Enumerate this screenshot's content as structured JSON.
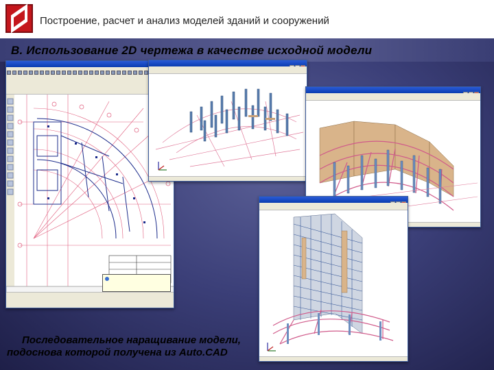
{
  "header": {
    "title": "Построение, расчет и анализ моделей зданий и сооружений",
    "brand_color": "#c4161c"
  },
  "subtitle": "B. Использование 2D чертежа в качестве исходной модели",
  "caption": {
    "line1": "Последовательное наращивание модели,",
    "line2": "подоснова которой получена из Auto.CAD"
  },
  "windows": {
    "autocad": {
      "icons": [
        "autocad-icon"
      ]
    },
    "model_a": {
      "icons": [
        "model-icon"
      ]
    },
    "model_b": {
      "icons": [
        "model-icon"
      ]
    },
    "model_c": {
      "icons": [
        "model-icon"
      ]
    }
  }
}
